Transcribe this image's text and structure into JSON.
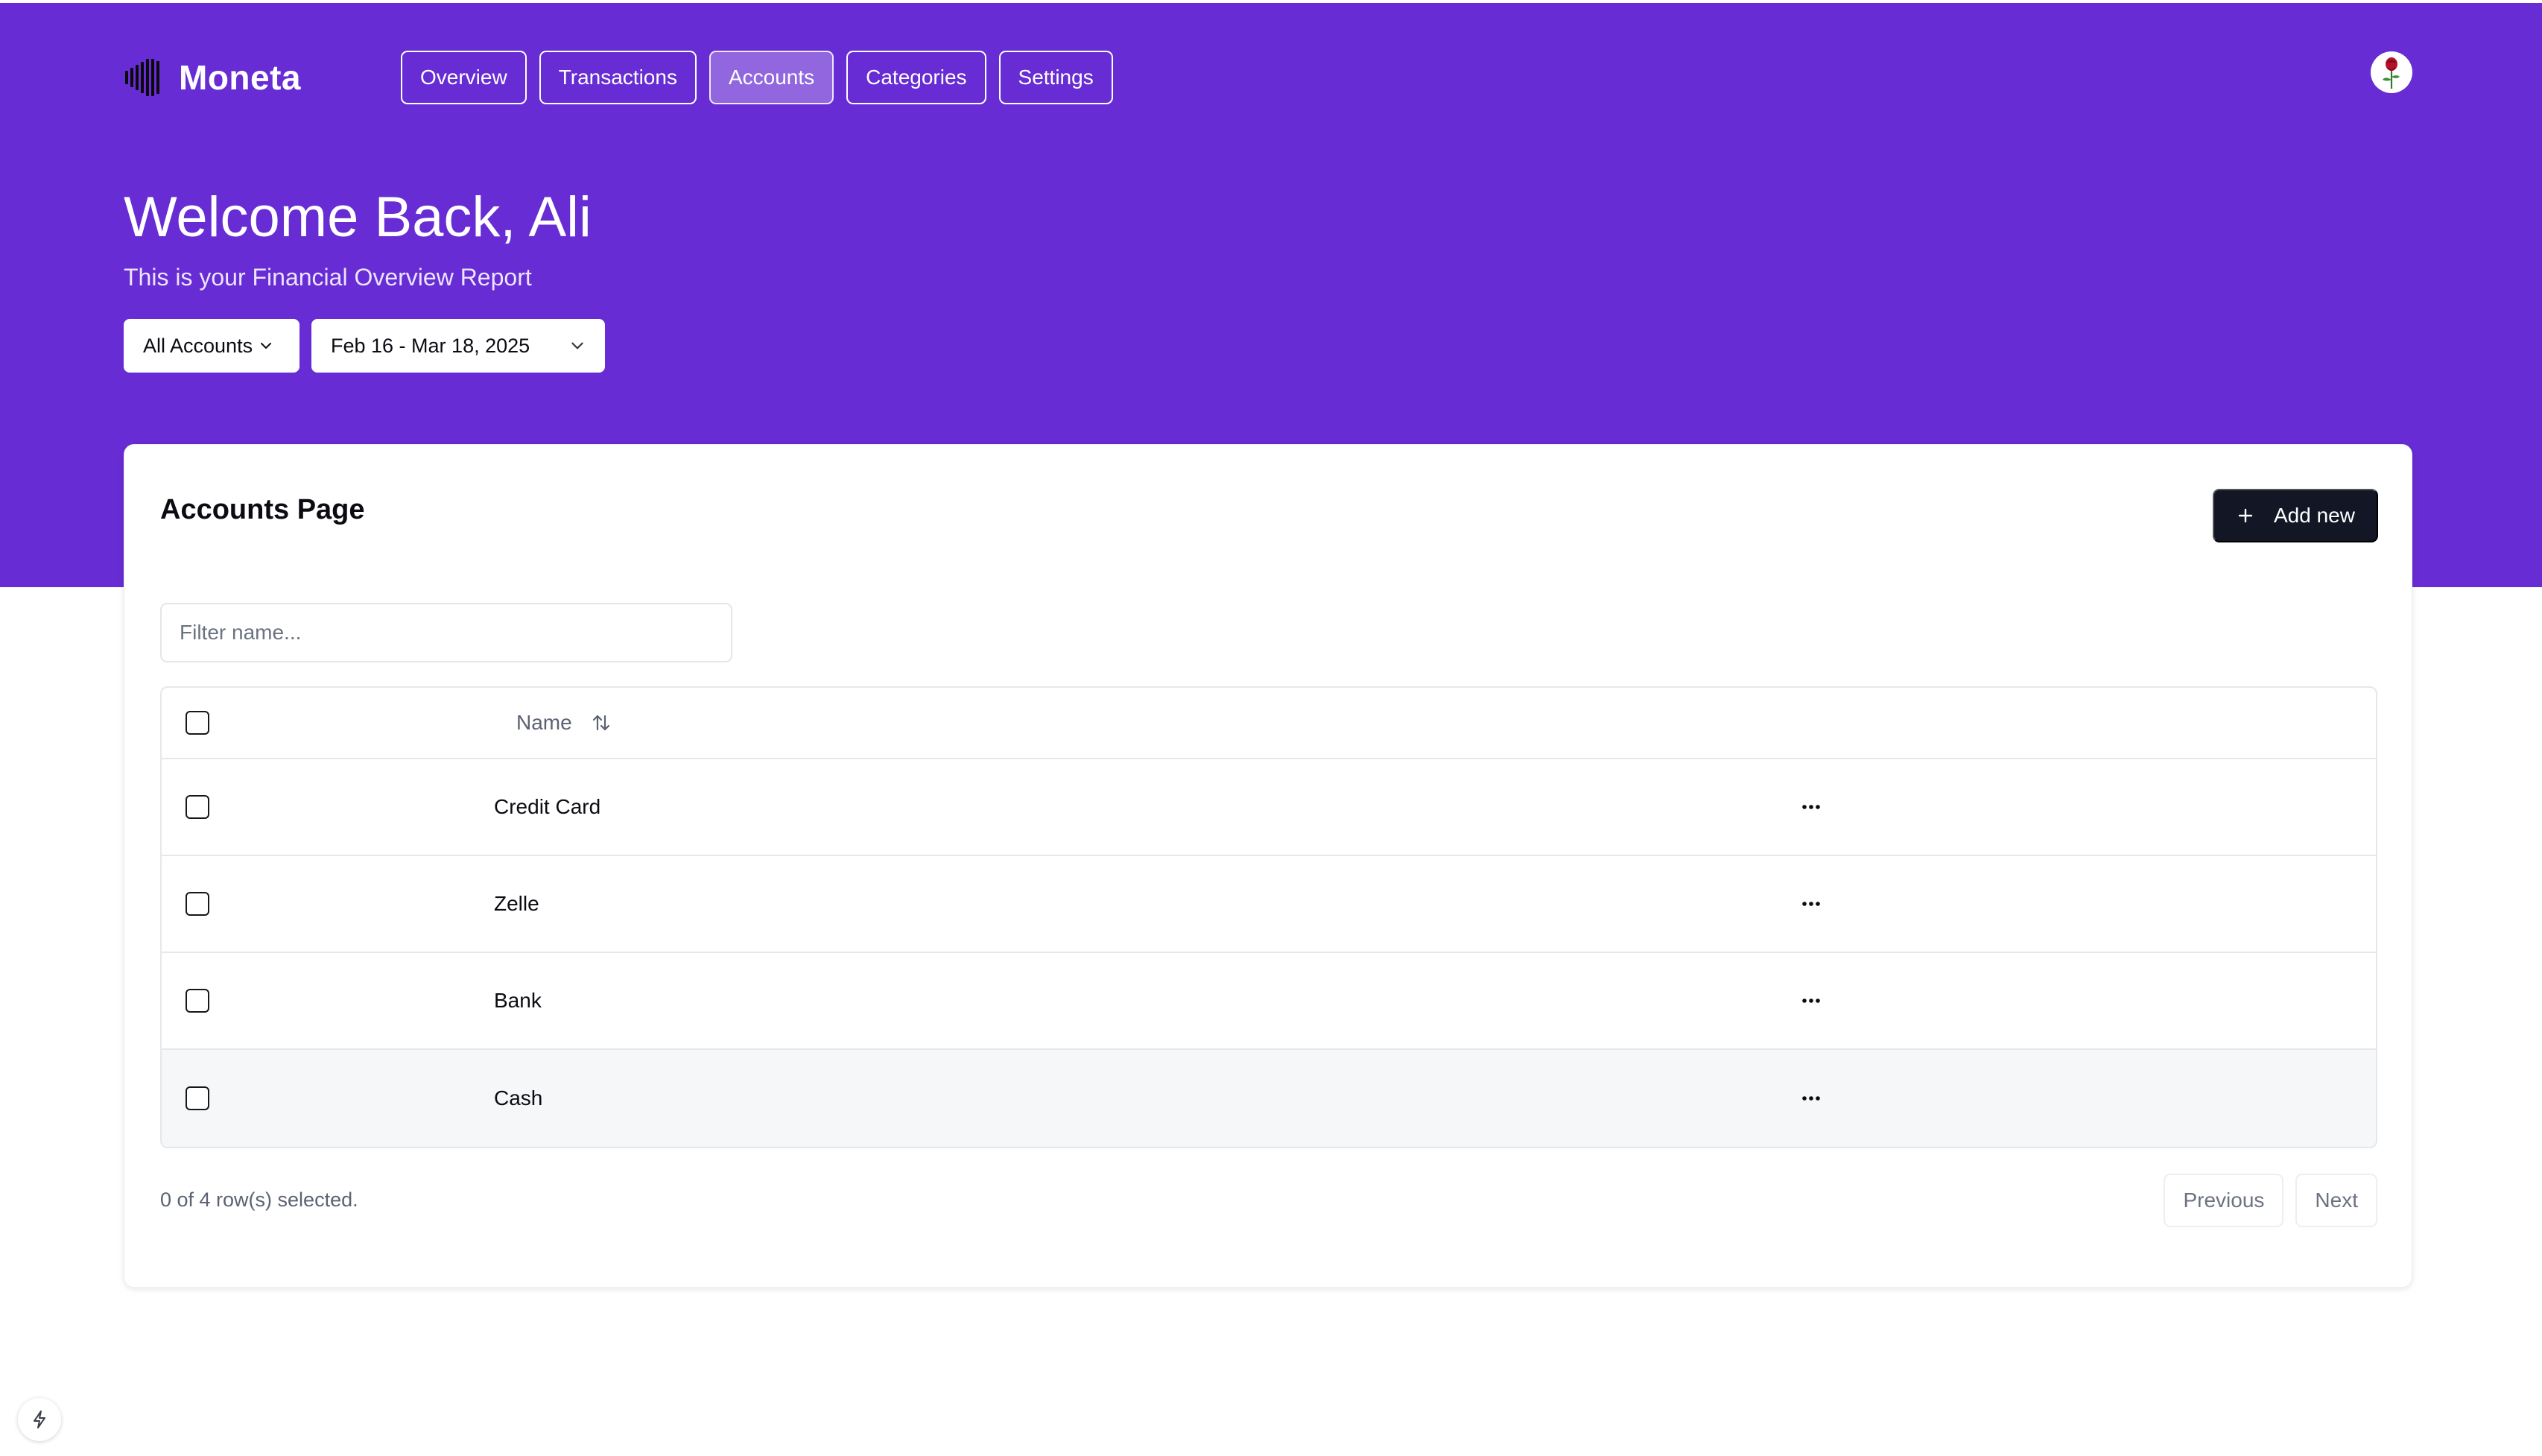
{
  "app": {
    "name": "Moneta"
  },
  "nav": {
    "items": [
      {
        "label": "Overview",
        "active": false
      },
      {
        "label": "Transactions",
        "active": false
      },
      {
        "label": "Accounts",
        "active": true
      },
      {
        "label": "Categories",
        "active": false
      },
      {
        "label": "Settings",
        "active": false
      }
    ]
  },
  "user": {
    "avatar_icon": "rose-icon"
  },
  "header": {
    "welcome": "Welcome Back, Ali",
    "subtitle": "This is your Financial Overview Report"
  },
  "filters": {
    "account_select": "All Accounts",
    "date_range": "Feb 16 - Mar 18, 2025"
  },
  "card": {
    "title": "Accounts Page",
    "add_button_label": "Add new",
    "filter_placeholder": "Filter name..."
  },
  "table": {
    "columns": [
      "Name"
    ],
    "rows": [
      {
        "name": "Credit Card"
      },
      {
        "name": "Zelle"
      },
      {
        "name": "Bank"
      },
      {
        "name": "Cash"
      }
    ]
  },
  "footer": {
    "selection": "0 of 4 row(s) selected.",
    "previous_label": "Previous",
    "next_label": "Next"
  },
  "colors": {
    "brand": "#672cd3",
    "primary_button": "#131725"
  }
}
